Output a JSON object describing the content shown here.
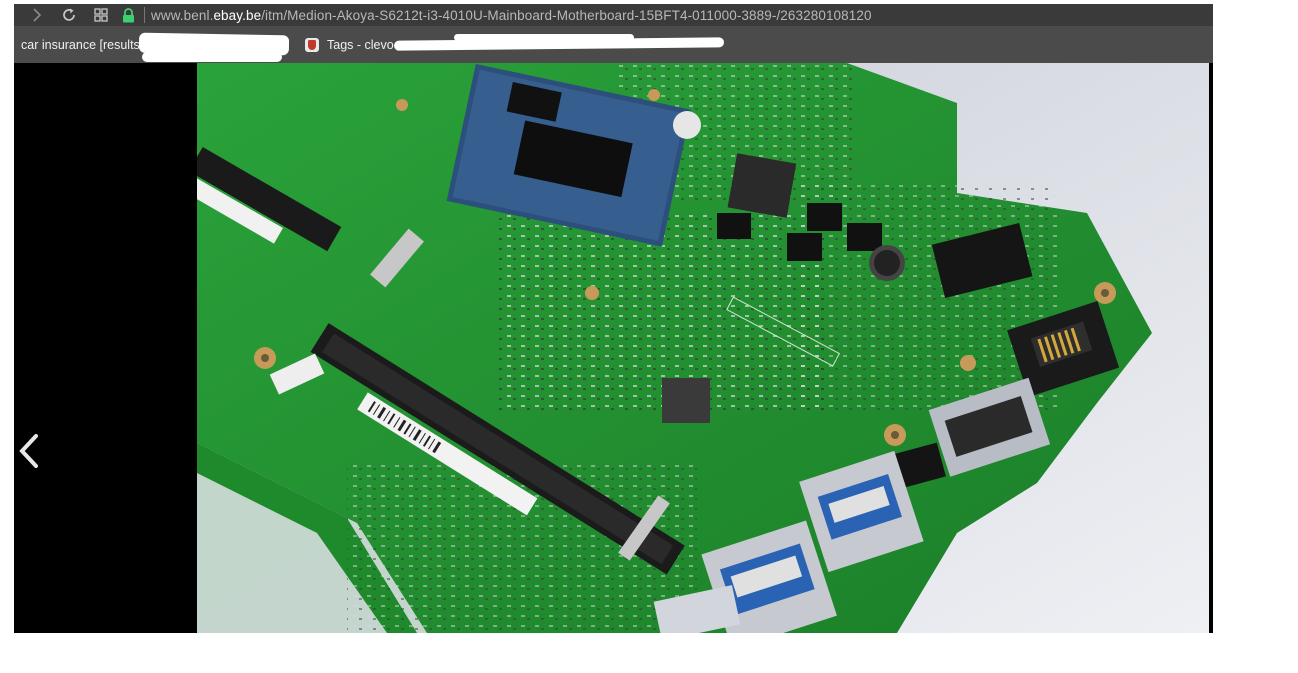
{
  "toolbar": {
    "url_domain_prefix": "www.benl.",
    "url_domain_main": "ebay.be",
    "url_path": "/itm/Medion-Akoya-S6212t-i3-4010U-Mainboard-Motherboard-15BFT4-011000-3889-/263280108120"
  },
  "bookmarks": [
    {
      "label": "car insurance [results"
    },
    {
      "label": "Tags - clevo"
    }
  ],
  "colors": {
    "toolbar_bg": "#3a3a3a",
    "bookmarks_bg": "#4b4b4b",
    "lock_green": "#3cd070",
    "pcb_green": "#1f8a2c",
    "background_surface": "#d9dce3"
  },
  "icons": [
    "forward-icon",
    "reload-icon",
    "apps-grid-icon",
    "lock-icon",
    "bookmark-favicon",
    "chevron-left-icon"
  ]
}
